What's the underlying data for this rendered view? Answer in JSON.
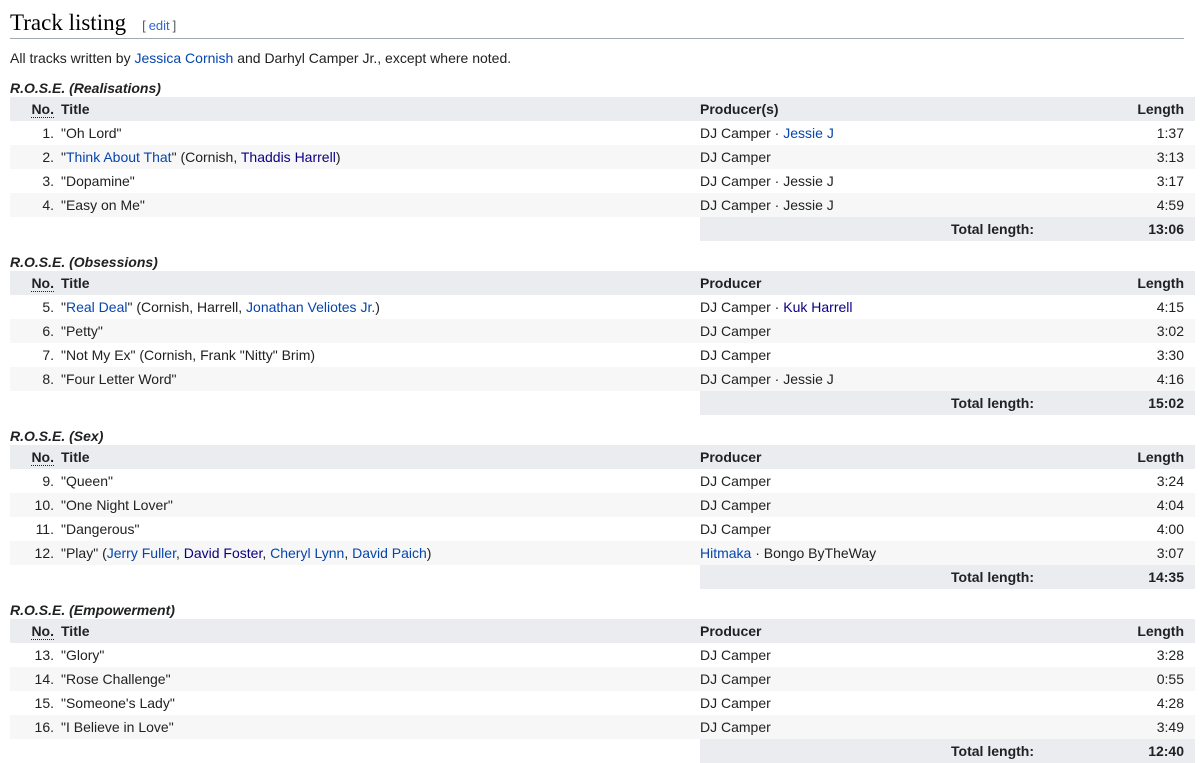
{
  "heading": "Track listing",
  "edit_label": "edit",
  "edit_open": "[",
  "edit_close": "]",
  "intro": {
    "prefix": "All tracks written by ",
    "link": "Jessica Cornish",
    "suffix": " and Darhyl Camper Jr., except where noted."
  },
  "columns": {
    "no": "No.",
    "title": "Title",
    "length": "Length"
  },
  "total_label": "Total length:",
  "sections": [
    {
      "title": "R.O.S.E. (Realisations)",
      "producer_header": "Producer(s)",
      "total": "13:06",
      "tracks": [
        {
          "no": "1.",
          "title": [
            {
              "t": "\"Oh Lord\""
            }
          ],
          "producer": [
            {
              "t": "DJ Camper"
            },
            {
              "t": " · "
            },
            {
              "t": "Jessie J",
              "link": true
            }
          ],
          "length": "1:37"
        },
        {
          "no": "2.",
          "title": [
            {
              "t": "\""
            },
            {
              "t": "Think About That",
              "link": true
            },
            {
              "t": "\" (Cornish, "
            },
            {
              "t": "Thaddis Harrell",
              "link": true,
              "visited": true
            },
            {
              "t": ")"
            }
          ],
          "producer": [
            {
              "t": "DJ Camper"
            }
          ],
          "length": "3:13"
        },
        {
          "no": "3.",
          "title": [
            {
              "t": "\"Dopamine\""
            }
          ],
          "producer": [
            {
              "t": "DJ Camper · Jessie J"
            }
          ],
          "length": "3:17"
        },
        {
          "no": "4.",
          "title": [
            {
              "t": "\"Easy on Me\""
            }
          ],
          "producer": [
            {
              "t": "DJ Camper · Jessie J"
            }
          ],
          "length": "4:59"
        }
      ]
    },
    {
      "title": "R.O.S.E. (Obsessions)",
      "producer_header": "Producer",
      "total": "15:02",
      "tracks": [
        {
          "no": "5.",
          "title": [
            {
              "t": "\""
            },
            {
              "t": "Real Deal",
              "link": true
            },
            {
              "t": "\" (Cornish, Harrell, "
            },
            {
              "t": "Jonathan Veliotes Jr.",
              "link": true
            },
            {
              "t": ")"
            }
          ],
          "producer": [
            {
              "t": "DJ Camper"
            },
            {
              "t": " · "
            },
            {
              "t": "Kuk Harrell",
              "link": true,
              "visited": true
            }
          ],
          "length": "4:15"
        },
        {
          "no": "6.",
          "title": [
            {
              "t": "\"Petty\""
            }
          ],
          "producer": [
            {
              "t": "DJ Camper"
            }
          ],
          "length": "3:02"
        },
        {
          "no": "7.",
          "title": [
            {
              "t": "\"Not My Ex\" (Cornish, Frank \"Nitty\" Brim)"
            }
          ],
          "producer": [
            {
              "t": "DJ Camper"
            }
          ],
          "length": "3:30"
        },
        {
          "no": "8.",
          "title": [
            {
              "t": "\"Four Letter Word\""
            }
          ],
          "producer": [
            {
              "t": "DJ Camper · Jessie J"
            }
          ],
          "length": "4:16"
        }
      ]
    },
    {
      "title": "R.O.S.E. (Sex)",
      "producer_header": "Producer",
      "total": "14:35",
      "tracks": [
        {
          "no": "9.",
          "title": [
            {
              "t": "\"Queen\""
            }
          ],
          "producer": [
            {
              "t": "DJ Camper"
            }
          ],
          "length": "3:24"
        },
        {
          "no": "10.",
          "title": [
            {
              "t": "\"One Night Lover\""
            }
          ],
          "producer": [
            {
              "t": "DJ Camper"
            }
          ],
          "length": "4:04"
        },
        {
          "no": "11.",
          "title": [
            {
              "t": "\"Dangerous\""
            }
          ],
          "producer": [
            {
              "t": "DJ Camper"
            }
          ],
          "length": "4:00"
        },
        {
          "no": "12.",
          "title": [
            {
              "t": "\"Play\" ("
            },
            {
              "t": "Jerry Fuller",
              "link": true
            },
            {
              "t": ", "
            },
            {
              "t": "David Foster",
              "link": true,
              "visited": true
            },
            {
              "t": ", "
            },
            {
              "t": "Cheryl Lynn",
              "link": true
            },
            {
              "t": ", "
            },
            {
              "t": "David Paich",
              "link": true
            },
            {
              "t": ")"
            }
          ],
          "producer": [
            {
              "t": "Hitmaka",
              "link": true
            },
            {
              "t": " · Bongo ByTheWay"
            }
          ],
          "length": "3:07"
        }
      ]
    },
    {
      "title": "R.O.S.E. (Empowerment)",
      "producer_header": "Producer",
      "total": "12:40",
      "tracks": [
        {
          "no": "13.",
          "title": [
            {
              "t": "\"Glory\""
            }
          ],
          "producer": [
            {
              "t": "DJ Camper"
            }
          ],
          "length": "3:28"
        },
        {
          "no": "14.",
          "title": [
            {
              "t": "\"Rose Challenge\""
            }
          ],
          "producer": [
            {
              "t": "DJ Camper"
            }
          ],
          "length": "0:55"
        },
        {
          "no": "15.",
          "title": [
            {
              "t": "\"Someone's Lady\""
            }
          ],
          "producer": [
            {
              "t": "DJ Camper"
            }
          ],
          "length": "4:28"
        },
        {
          "no": "16.",
          "title": [
            {
              "t": "\"I Believe in Love\""
            }
          ],
          "producer": [
            {
              "t": "DJ Camper"
            }
          ],
          "length": "3:49"
        }
      ]
    }
  ]
}
